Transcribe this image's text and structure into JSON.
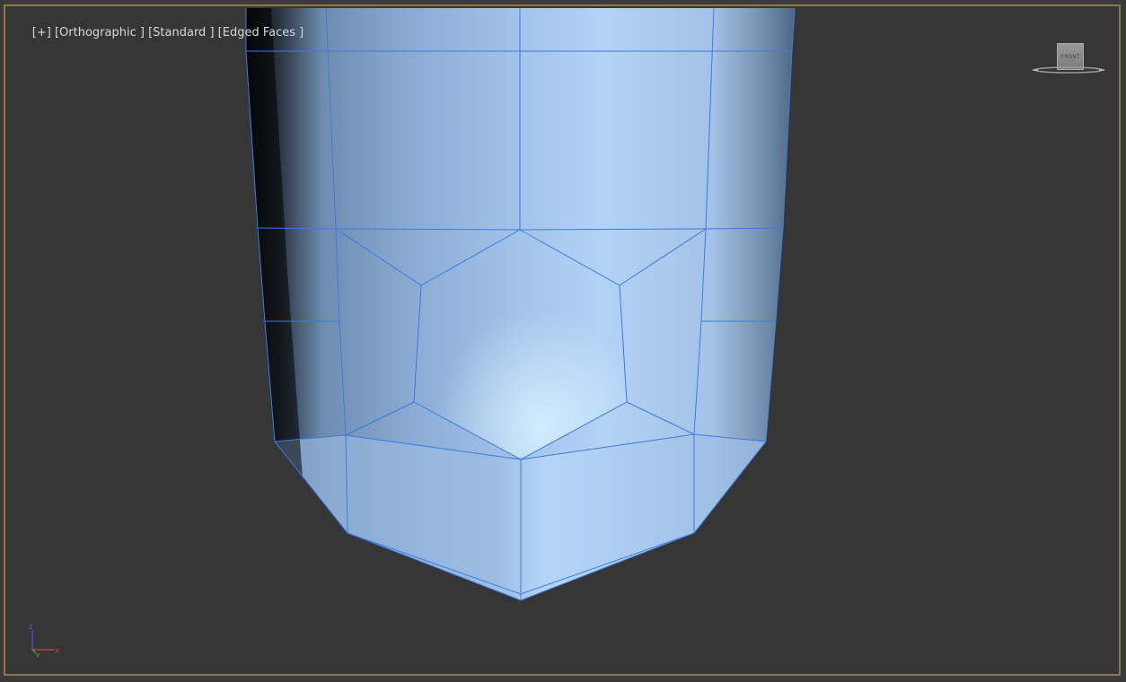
{
  "viewport": {
    "label_plus": "[+]",
    "label_view": "[Orthographic ]",
    "label_shading": "[Standard ]",
    "label_edges": "[Edged Faces ]"
  },
  "viewcube": {
    "face": "FRONT",
    "icon": "viewcube-icon"
  },
  "axis_tripod": {
    "z_label": "z",
    "x_label": "x",
    "y_label": "y",
    "colors": {
      "x": "#e04040",
      "y": "#40c040",
      "z": "#4060e0"
    }
  },
  "colors": {
    "frame_border": "#8c7a45",
    "background": "#363636",
    "mesh_fill": "#a8c8ee",
    "mesh_edge": "#3c7ae0"
  }
}
